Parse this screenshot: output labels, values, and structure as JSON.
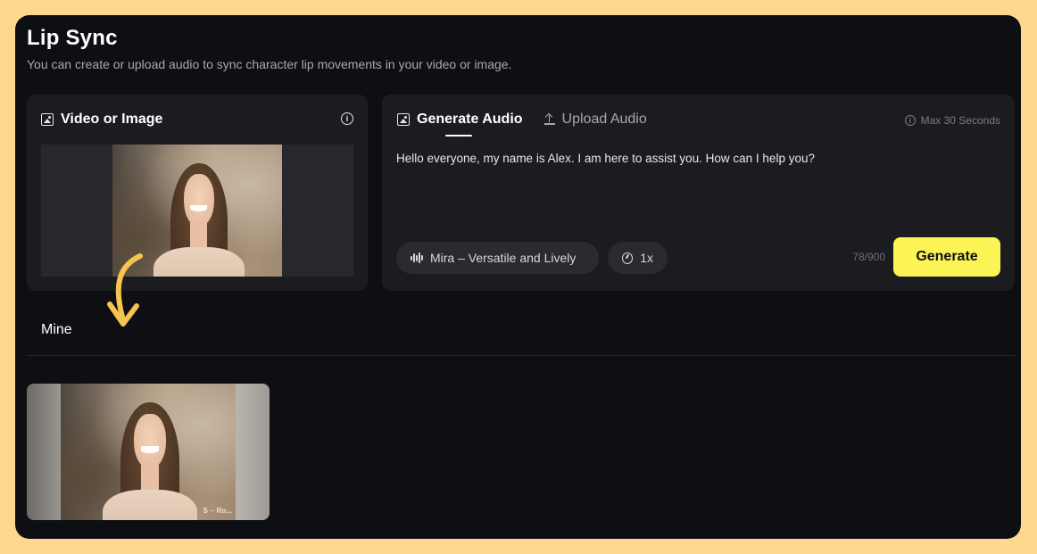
{
  "header": {
    "title": "Lip Sync",
    "subtitle": "You can create or upload audio to sync character lip movements in your video or image."
  },
  "media_panel": {
    "title": "Video or Image",
    "icon": "image-icon",
    "info_icon": "info-icon"
  },
  "audio_panel": {
    "tabs": [
      {
        "label": "Generate Audio",
        "active": true,
        "icon": "image-icon"
      },
      {
        "label": "Upload Audio",
        "active": false,
        "icon": "upload-icon"
      }
    ],
    "max_note": "Max 30 Seconds",
    "script": "Hello everyone, my name is Alex. I am here to assist you. How can I help you?",
    "voice": "Mira – Versatile and Lively",
    "speed": "1x",
    "char_count": "78/900",
    "generate_label": "Generate"
  },
  "results": {
    "section_label": "Mine",
    "watermark": "S ·· Ro..."
  },
  "colors": {
    "outer_bg": "#fdd98f",
    "app_bg": "#0e0f12",
    "card_bg": "#1b1c20",
    "pill_bg": "#2a2b30",
    "accent_yellow": "#fcf355",
    "arrow": "#f5c451"
  }
}
